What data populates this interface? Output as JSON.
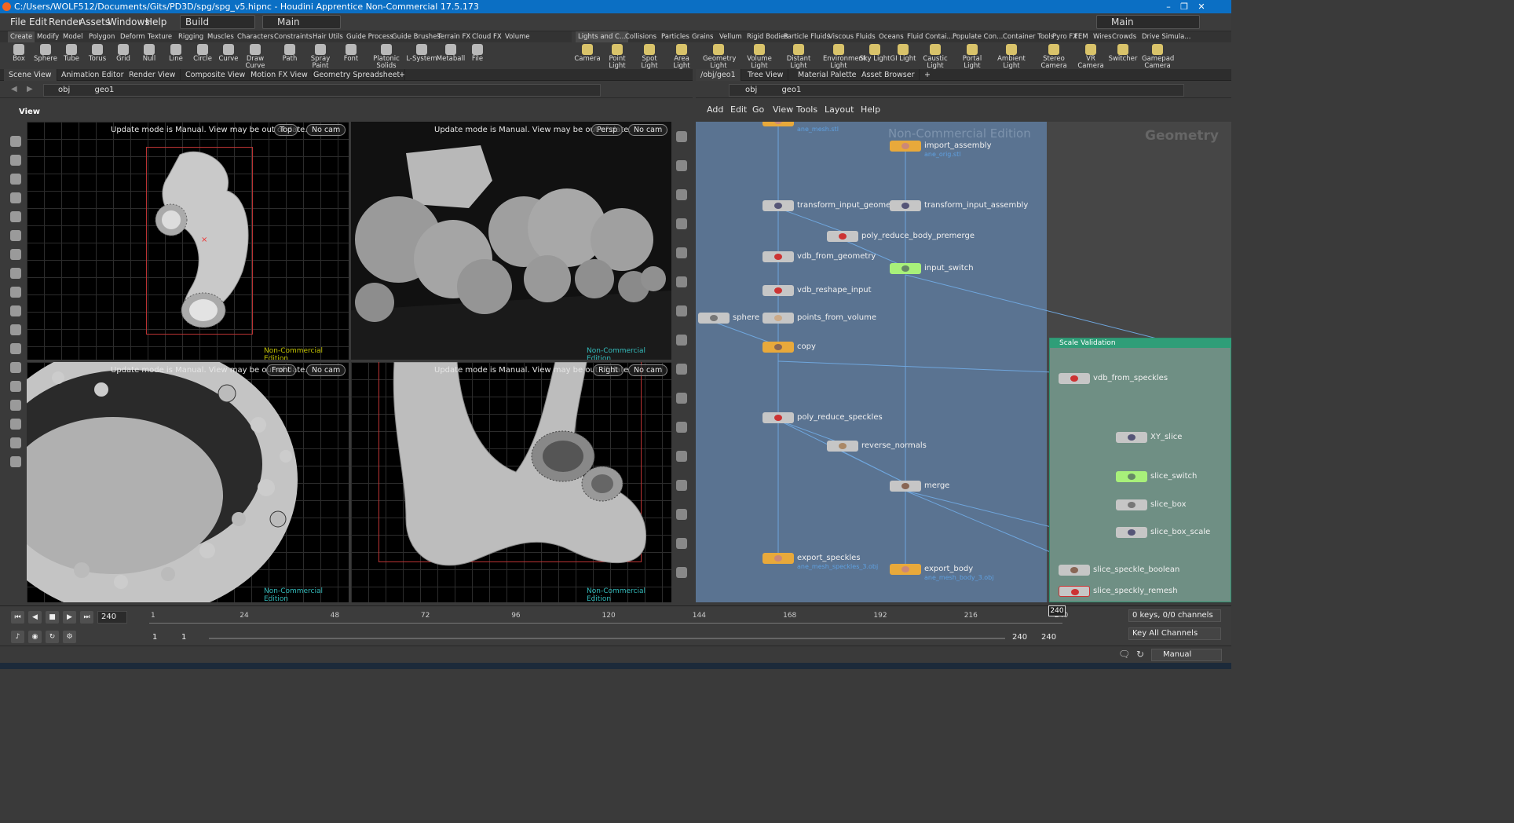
{
  "window": {
    "title": "C:/Users/WOLF512/Documents/Gits/PD3D/spg/spg_v5.hipnc - Houdini Apprentice Non-Commercial 17.5.173"
  },
  "menubar": {
    "items": [
      "File",
      "Edit",
      "Render",
      "Assets",
      "Windows",
      "Help"
    ],
    "desktop": "Build",
    "context": "Main",
    "right_context": "Main"
  },
  "shelf_left": {
    "tabs": [
      "Create",
      "Modify",
      "Model",
      "Polygon",
      "Deform",
      "Texture",
      "Rigging",
      "Muscles",
      "Characters",
      "Constraints",
      "Hair Utils",
      "Guide Process",
      "Guide Brushes",
      "Terrain FX",
      "Cloud FX",
      "Volume"
    ],
    "tools": [
      "Box",
      "Sphere",
      "Tube",
      "Torus",
      "Grid",
      "Null",
      "Line",
      "Circle",
      "Curve",
      "Draw Curve",
      "Path",
      "Spray Paint",
      "Font",
      "Platonic Solids",
      "L-System",
      "Metaball",
      "File"
    ]
  },
  "shelf_right": {
    "tabs": [
      "Lights and C...",
      "Collisions",
      "Particles",
      "Grains",
      "Vellum",
      "Rigid Bodies",
      "Particle Fluids",
      "Viscous Fluids",
      "Oceans",
      "Fluid Contai...",
      "Populate Con...",
      "Container Tools",
      "Pyro FX",
      "FEM",
      "Wires",
      "Crowds",
      "Drive Simula..."
    ],
    "tools": [
      "Camera",
      "Point Light",
      "Spot Light",
      "Area Light",
      "Geometry Light",
      "Volume Light",
      "Distant Light",
      "Environment Light",
      "Sky Light",
      "GI Light",
      "Caustic Light",
      "Portal Light",
      "Ambient Light",
      "Stereo Camera",
      "VR Camera",
      "Switcher",
      "Gamepad Camera"
    ]
  },
  "left_pane": {
    "tabs": [
      "Scene View",
      "Animation Editor",
      "Render View",
      "Composite View",
      "Motion FX View",
      "Geometry Spreadsheet"
    ],
    "path": [
      "obj",
      "geo1"
    ],
    "view_label": "View"
  },
  "viewports": [
    {
      "message": "Update mode is Manual. View may be out of date.",
      "view": "Top",
      "camera": "No cam",
      "watermark": "Non-Commercial Edition"
    },
    {
      "message": "Update mode is Manual. View may be out of date.",
      "view": "Persp",
      "camera": "No cam",
      "watermark": "Non-Commercial Edition"
    },
    {
      "message": "Update mode is Manual. View may be out of date.",
      "view": "Front",
      "camera": "No cam",
      "watermark": "Non-Commercial Edition"
    },
    {
      "message": "Update mode is Manual. View may be out of date.",
      "view": "Right",
      "camera": "No cam",
      "watermark": "Non-Commercial Edition"
    }
  ],
  "right_pane": {
    "tabs": [
      "/obj/geo1",
      "Tree View",
      "Material Palette",
      "Asset Browser"
    ],
    "path": [
      "obj",
      "geo1"
    ],
    "menu": [
      "Add",
      "Edit",
      "Go",
      "View",
      "Tools",
      "Layout",
      "Help"
    ],
    "watermark": "Non-Commercial Edition",
    "context_label": "Geometry"
  },
  "nodes": {
    "ane_mesh": {
      "sub": "ane_mesh.stl"
    },
    "import_assembly": {
      "label": "import_assembly",
      "sub": "ane_orig.stl"
    },
    "transform_input_geometry": {
      "label": "transform_input_geometry"
    },
    "transform_input_assembly": {
      "label": "transform_input_assembly"
    },
    "poly_reduce_body_premerge": {
      "label": "poly_reduce_body_premerge"
    },
    "vdb_from_geometry": {
      "label": "vdb_from_geometry"
    },
    "input_switch": {
      "label": "input_switch"
    },
    "vdb_reshape_input": {
      "label": "vdb_reshape_input"
    },
    "sphere": {
      "label": "sphere"
    },
    "points_from_volume": {
      "label": "points_from_volume"
    },
    "copy": {
      "label": "copy"
    },
    "poly_reduce_speckles": {
      "label": "poly_reduce_speckles"
    },
    "reverse_normals": {
      "label": "reverse_normals"
    },
    "merge": {
      "label": "merge"
    },
    "export_speckles": {
      "label": "export_speckles",
      "sub": "ane_mesh_speckles_3.obj"
    },
    "export_body": {
      "label": "export_body",
      "sub": "ane_mesh_body_3.obj"
    },
    "vdb_from_speckles": {
      "label": "vdb_from_speckles"
    },
    "xy_slice": {
      "label": "XY_slice"
    },
    "slice_switch": {
      "label": "slice_switch"
    },
    "slice_box": {
      "label": "slice_box"
    },
    "slice_box_scale": {
      "label": "slice_box_scale"
    },
    "slice_speckle_boolean": {
      "label": "slice_speckle_boolean"
    },
    "slice_speckly_remesh": {
      "label": "slice_speckly_remesh"
    }
  },
  "netbox": {
    "title": "Scale Validation"
  },
  "timeline": {
    "frame": "240",
    "ticks": [
      "1",
      "24",
      "48",
      "72",
      "96",
      "120",
      "144",
      "168",
      "192",
      "216",
      "240"
    ],
    "range_start": "1",
    "range_start2": "1",
    "range_end": "240",
    "range_end2": "240",
    "keys": "0 keys, 0/0 channels",
    "key_all": "Key All Channels",
    "update_mode": "Manual"
  },
  "colors": {
    "titlebar": "#0b6fc4",
    "network_bg": "#5a7391",
    "netbox": "#2f9e78"
  }
}
